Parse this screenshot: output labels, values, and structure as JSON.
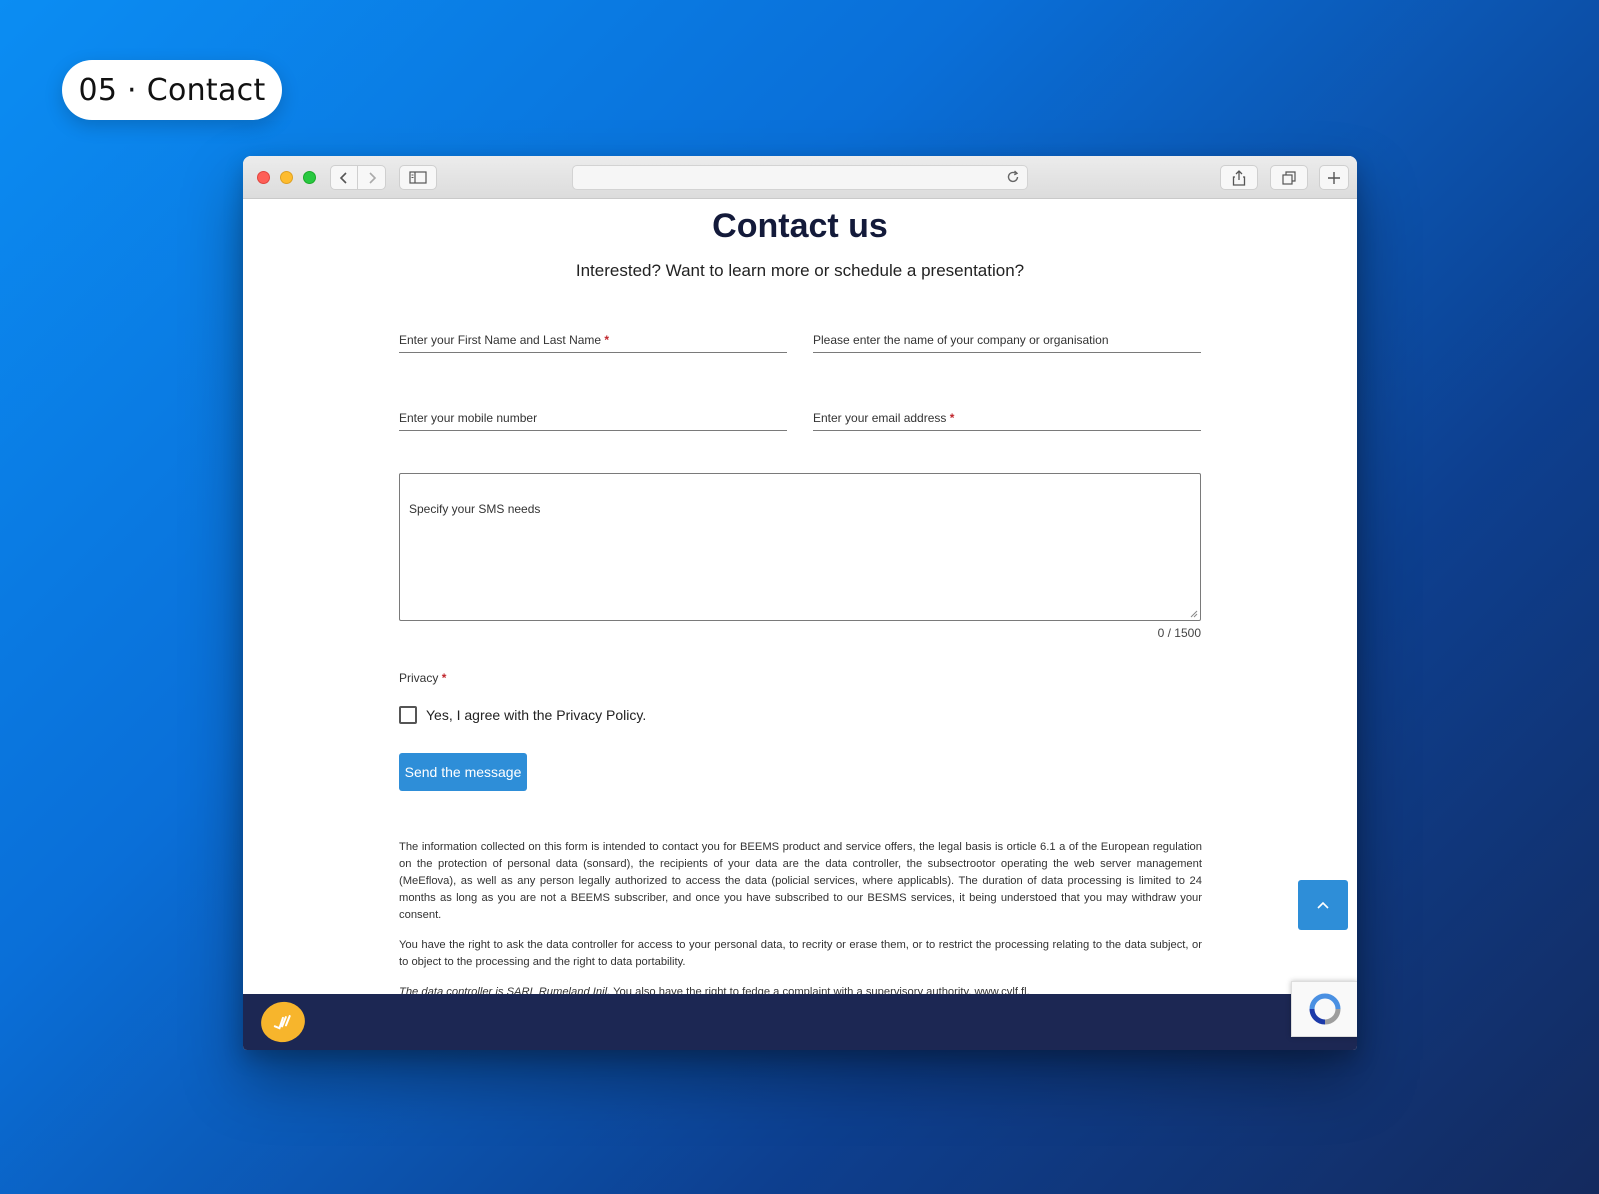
{
  "badge": {
    "label": "05 · Contact"
  },
  "browser": {
    "nav_back_icon": "chevron-left-icon",
    "nav_forward_icon": "chevron-right-icon",
    "sidebar_icon": "sidebar-icon",
    "reload_icon": "reload-icon",
    "share_icon": "share-icon",
    "tabs_icon": "tabs-icon",
    "new_tab_icon": "plus-icon"
  },
  "page": {
    "title": "Contact us",
    "subtitle": "Interested? Want to learn more or schedule a presentation?",
    "form": {
      "name_label": "Enter your First Name and Last Name",
      "company_label": "Please enter the name of your company or organisation",
      "mobile_label": "Enter your mobile number",
      "email_label": "Enter your email address",
      "required_mark": "*",
      "message_placeholder": "Specify your SMS needs",
      "counter": "0 / 1500",
      "privacy_label": "Privacy",
      "privacy_checkbox_label": "Yes, I agree with the Privacy Policy.",
      "submit_label": "Send the message"
    },
    "legal": {
      "p1": "The information collected on this form is intended to contact you for BEEMS product and service offers, the legal basis is orticle 6.1 a of the European regulation on the protection of personal data (sonsard), the recipients of your data are the data controller, the subsectrootor operating the web server management (MeEflova), as well as any person legally authorized to access the data (policial services, where applicabls). The duration of data processing is limited to 24 months as long as you are not a BEEMS subscriber, and once you have subscribed to our BESMS services, it being understoed that you may withdraw your consent.",
      "p2": "You have the right to ask the data controller for access to your personal data, to recrity or erase them, or to restrict the processing relating to the data subject, or to object to the processing and the right to data portability.",
      "p3_italic": "The data controller is SARL Rumeland Inil.",
      "p3_rest": " You also have the right to fedge a complaint with a supervisory authority, www.cvlf.fl."
    },
    "scroll_top_icon": "chevron-up-icon"
  },
  "footer": {
    "logo_icon": "logo-icon"
  },
  "recaptcha": {
    "icon": "recaptcha-icon"
  }
}
